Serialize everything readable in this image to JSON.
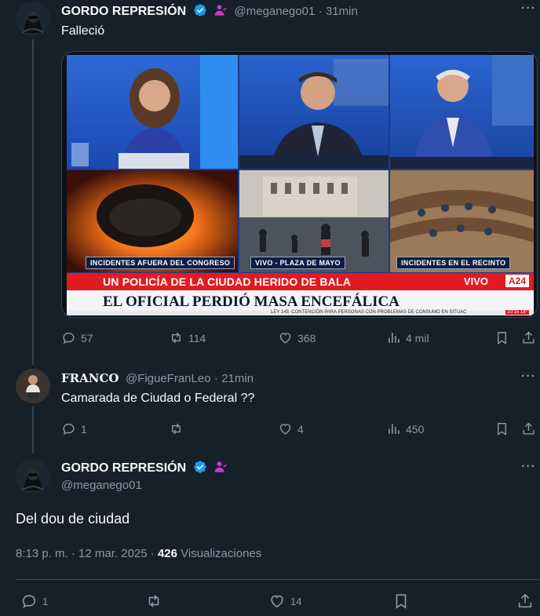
{
  "tweet1": {
    "author_name": "GORDO REPRESIÓN",
    "handle": "@meganego01",
    "time": "31min",
    "text": "Falleció",
    "media": {
      "tag_left": "INCIDENTES AFUERA DEL CONGRESO",
      "tag_mid": "VIVO - PLAZA DE MAYO",
      "tag_right": "INCIDENTES EN EL RECINTO",
      "headline_top": "UN POLICÍA DE LA CIUDAD HERIDO DE BALA",
      "headline_main": "EL OFICIAL PERDIÓ MASA ENCEFÁLICA",
      "live_label": "VIVO",
      "channel": "A24",
      "ticker": "LEY 145: CONTENCIÓN PARA PERSONAS CON PROBLEMAS DE CONSUMO EN SITUAC",
      "clock": "10:15 18°"
    },
    "replies": "57",
    "reposts": "114",
    "likes": "368",
    "views": "4 mil"
  },
  "tweet2": {
    "author_name": "FRANCO",
    "handle": "@FigueFranLeo",
    "time": "21min",
    "text": "Camarada de Ciudad o Federal ??",
    "replies": "1",
    "reposts": "",
    "likes": "4",
    "views": "450"
  },
  "main_tweet": {
    "author_name": "GORDO REPRESIÓN",
    "handle": "@meganego01",
    "text": "Del dou de ciudad",
    "timestamp": "8:13 p. m. · 12 mar. 2025 ·",
    "views_count": "426",
    "views_label": "Visualizaciones",
    "replies": "1",
    "likes": "14"
  },
  "colors": {
    "background": "#15202b",
    "verified": "#1d9bf0",
    "affiliate": "#c936cc",
    "muted": "#8b98a5"
  }
}
